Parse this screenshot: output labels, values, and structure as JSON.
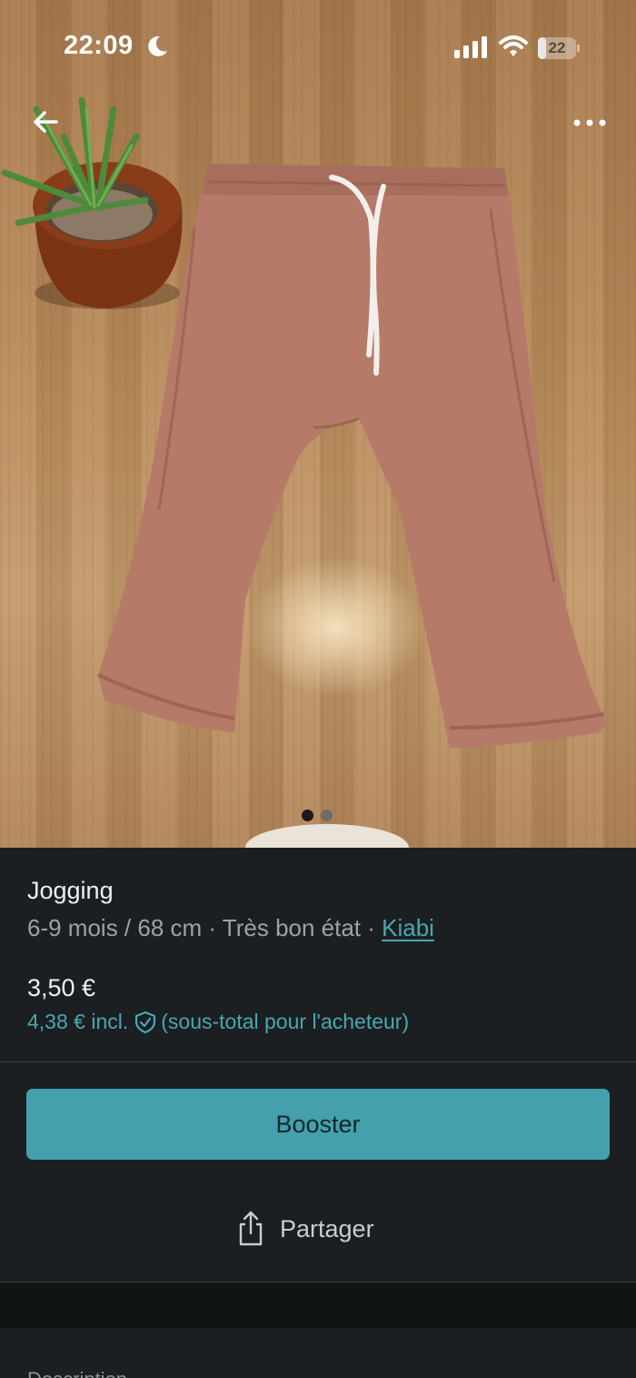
{
  "status_bar": {
    "time": "22:09",
    "battery_level": "22",
    "battery_fraction": 0.22
  },
  "photo": {
    "back_icon": "arrow-left-icon",
    "more_icon": "more-horizontal-icon",
    "carousel": {
      "count": 2,
      "active_index": 0
    }
  },
  "item": {
    "title": "Jogging",
    "meta_prefix": "6-9 mois / 68 cm · Très bon état · ",
    "brand": "Kiabi",
    "price": "3,50 €",
    "buyer_price": "4,38 € incl.",
    "buyer_note": "(sous-total pour l'acheteur)"
  },
  "actions": {
    "booster_label": "Booster",
    "share_label": "Partager",
    "share_icon": "share-icon"
  },
  "description": {
    "label": "Description"
  },
  "colors": {
    "background": "#1b1f21",
    "accent": "#44a0ad",
    "link": "#4aa7b2",
    "muted_text": "#9ca3a6"
  }
}
